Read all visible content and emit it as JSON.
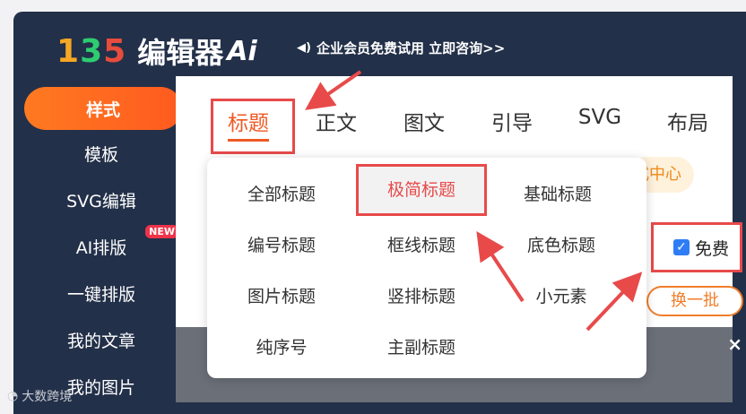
{
  "header": {
    "logo_digits": [
      "1",
      "3",
      "5"
    ],
    "logo_text": "编辑器",
    "logo_ai": "Ai",
    "notice": "企业会员免费试用 立即咨询>>"
  },
  "sidebar": {
    "items": [
      {
        "label": "样式",
        "active": true
      },
      {
        "label": "模板"
      },
      {
        "label": "SVG编辑"
      },
      {
        "label": "AI排版",
        "badge": "NEW"
      },
      {
        "label": "一键排版"
      },
      {
        "label": "我的文章"
      },
      {
        "label": "我的图片"
      }
    ]
  },
  "tabs": [
    "标题",
    "正文",
    "图文",
    "引导",
    "SVG",
    "布局"
  ],
  "style_center": "式中心",
  "dropdown": {
    "items": [
      {
        "label": "全部标题"
      },
      {
        "label": "极简标题"
      },
      {
        "label": "基础标题",
        "color": "red"
      },
      {
        "label": "编号标题"
      },
      {
        "label": "框线标题"
      },
      {
        "label": "底色标题"
      },
      {
        "label": "图片标题"
      },
      {
        "label": "竖排标题"
      },
      {
        "label": "小元素"
      },
      {
        "label": "纯序号"
      },
      {
        "label": "主副标题"
      }
    ]
  },
  "free_filter": {
    "label": "免费",
    "checked": true
  },
  "swap_button": "换一批",
  "close_label": "×",
  "watermark": "大数跨境",
  "colors": {
    "accent": "#ee5a24",
    "sidebar_bg": "#233049",
    "annotation_red": "#e84a4a",
    "checkbox_blue": "#2f7df6"
  }
}
